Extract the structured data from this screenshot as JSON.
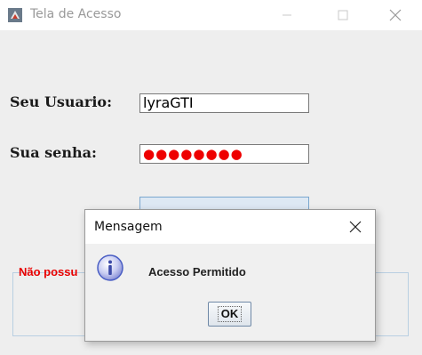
{
  "window": {
    "title": "Tela de Acesso",
    "icon": "java-cup-icon",
    "controls": [
      "minimize-icon",
      "maximize-icon",
      "close-icon"
    ]
  },
  "form": {
    "user_label": "Seu Usuario:",
    "user_value": "lyraGTI",
    "password_label": "Sua senha:",
    "password_mask": "●●●●●●●●",
    "password_color": "#ee0000",
    "login_button_label": "",
    "notice_text": "Não possu"
  },
  "dialog": {
    "title": "Mensagem",
    "icon": "info-icon",
    "message": "Acesso Permitido",
    "ok_label": "OK"
  },
  "colors": {
    "notice_red": "#e80000",
    "button_blue": "#dde8f3",
    "info_icon_blue": "#4a5ec4"
  }
}
